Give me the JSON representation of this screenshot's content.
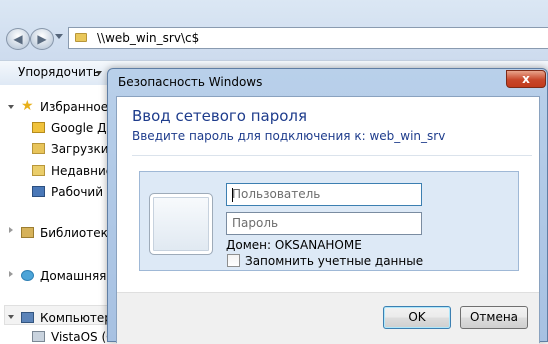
{
  "explorer": {
    "address": "\\\\web_win_srv\\c$",
    "toolbar": {
      "organize": "Упорядочить"
    },
    "nav": {
      "favorites": "Избранное",
      "favorites_items": [
        "Google Ди",
        "Загрузки",
        "Недавние",
        "Рабочий с"
      ],
      "libraries": "Библиотеки",
      "homegroup": "Домашняя г",
      "computer": "Компьютер",
      "computer_items": [
        "VistaOS (C:"
      ]
    }
  },
  "dialog": {
    "title": "Безопасность Windows",
    "close_glyph": "x",
    "heading": "Ввод сетевого пароля",
    "subtitle": "Введите пароль для подключения к: web_win_srv",
    "username_placeholder": "Пользователь",
    "password_placeholder": "Пароль",
    "domain": "Домен: OKSANAHOME",
    "remember_label": "Запомнить учетные данные",
    "remember_checked": false,
    "ok": "OK",
    "cancel": "Отмена"
  },
  "colors": {
    "heading": "#1e3c8c",
    "close_button": "#c8472a",
    "dialog_frame": "#b9d0ea",
    "credential_tile": "#dde9f6"
  }
}
